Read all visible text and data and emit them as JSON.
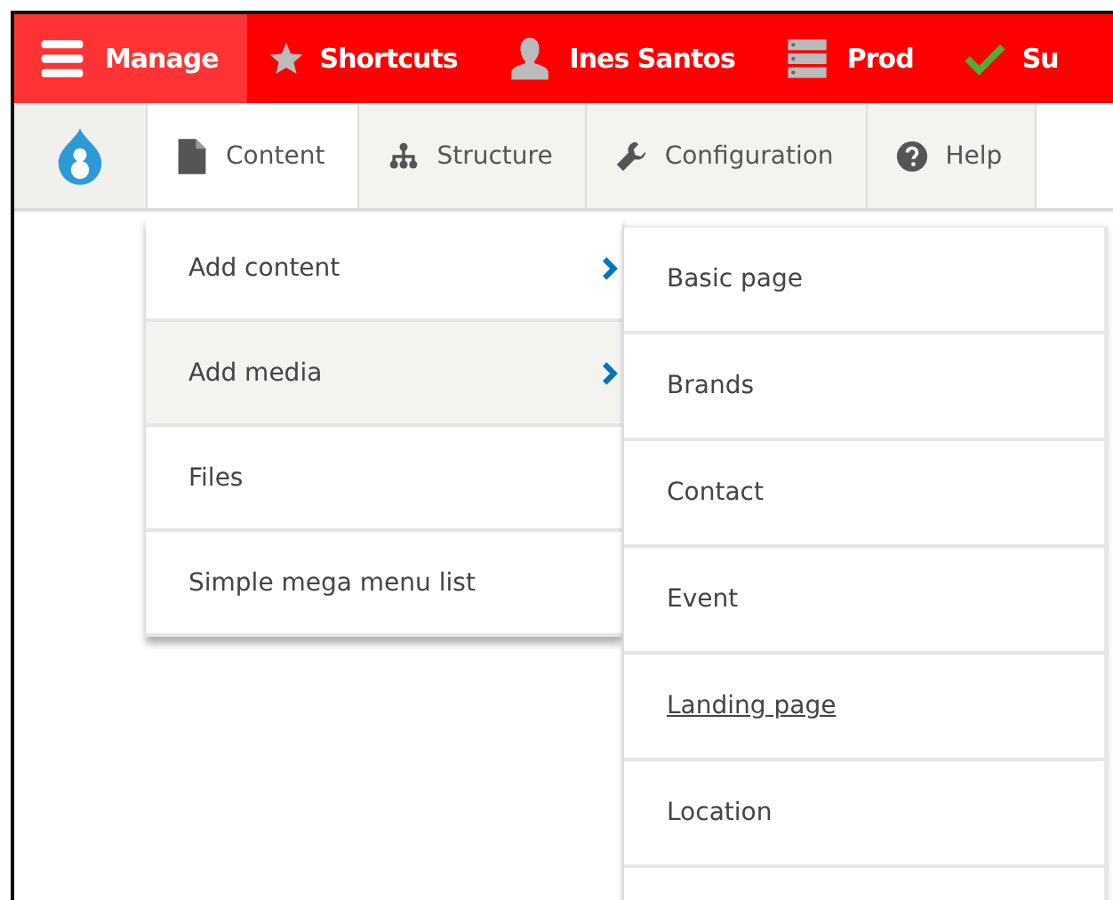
{
  "toolbar": [
    {
      "label": "Manage",
      "kind": "menu",
      "selected": true
    },
    {
      "label": "Shortcuts",
      "kind": "star",
      "selected": false
    },
    {
      "label": "Ines Santos",
      "kind": "person",
      "selected": false
    },
    {
      "label": "Prod",
      "kind": "server",
      "selected": false
    },
    {
      "label": "Su",
      "kind": "check",
      "selected": false
    }
  ],
  "tray": [
    {
      "label": "Content",
      "kind": "file",
      "selected": true
    },
    {
      "label": "Structure",
      "kind": "hierarchy",
      "selected": false
    },
    {
      "label": "Configuration",
      "kind": "wrench",
      "selected": false
    },
    {
      "label": "Help",
      "kind": "help",
      "selected": false
    }
  ],
  "menu": [
    {
      "label": "Add content",
      "has_submenu": true,
      "selected": false
    },
    {
      "label": "Add media",
      "has_submenu": true,
      "selected": true
    },
    {
      "label": "Files",
      "has_submenu": false,
      "selected": false
    },
    {
      "label": "Simple mega menu list",
      "has_submenu": false,
      "selected": false
    }
  ],
  "submenu": [
    {
      "label": "Basic page",
      "hovered": false
    },
    {
      "label": "Brands",
      "hovered": false
    },
    {
      "label": "Contact",
      "hovered": false
    },
    {
      "label": "Event",
      "hovered": false
    },
    {
      "label": "Landing page",
      "hovered": true
    },
    {
      "label": "Location",
      "hovered": false
    }
  ]
}
